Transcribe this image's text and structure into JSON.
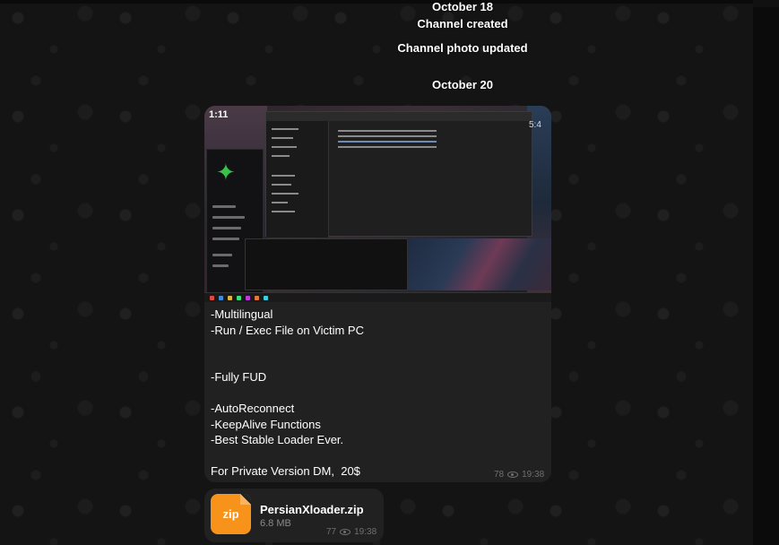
{
  "service_messages": {
    "date1": "October 18",
    "created": "Channel created",
    "photo_updated": "Channel photo updated",
    "date2": "October 20"
  },
  "post": {
    "photo": {
      "time_overlay": "1:11",
      "clock_overlay": "5:4"
    },
    "lines": [
      "-Multilingual",
      "-Run / Exec File on Victim PC",
      "",
      "",
      "-Fully FUD",
      "",
      "-AutoReconnect",
      "-KeepAlive Functions",
      "-Best Stable Loader Ever.",
      "",
      "For Private Version DM,  20$"
    ],
    "views": "78",
    "time": "19:38"
  },
  "file": {
    "icon_label": "zip",
    "name": "PersianXloader.zip",
    "size": "6.8 MB",
    "views": "77",
    "time": "19:38",
    "icon_color": "#f7931a"
  },
  "colors": {
    "bubble": "#212121",
    "background": "#141414",
    "meta": "#6f6f6f"
  }
}
